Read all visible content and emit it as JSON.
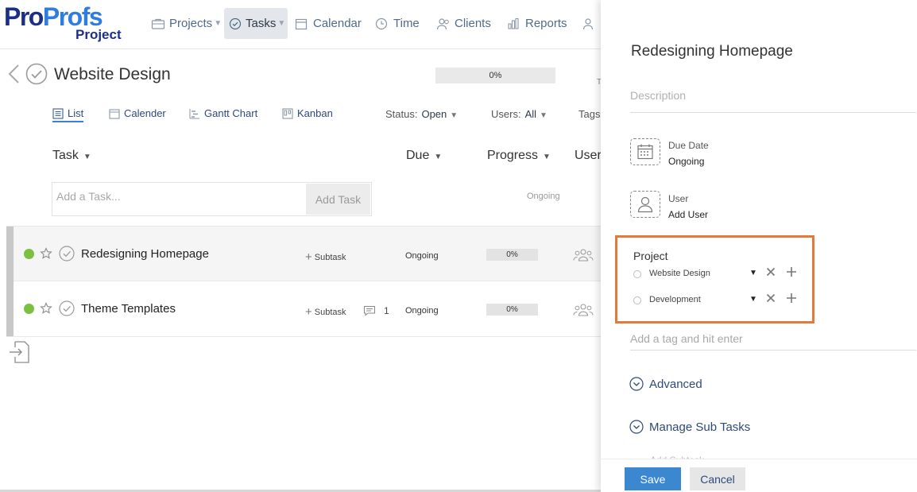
{
  "logo": {
    "part1": "Pro",
    "part2": "Profs",
    "sub": "Project"
  },
  "nav": {
    "projects": "Projects",
    "tasks": "Tasks",
    "calendar": "Calendar",
    "time": "Time",
    "clients": "Clients",
    "reports": "Reports",
    "users_partial": "U"
  },
  "project": {
    "title": "Website Design",
    "progress": "0%",
    "cut_letter": "T"
  },
  "views": {
    "list": "List",
    "calendar": "Calender",
    "gantt": "Gantt Chart",
    "kanban": "Kanban"
  },
  "filters": {
    "status_label": "Status:",
    "status_value": "Open",
    "users_label": "Users:",
    "users_value": "All",
    "tags_label": "Tags"
  },
  "columns": {
    "task": "Task",
    "due": "Due",
    "progress": "Progress",
    "users": "User"
  },
  "add_task": {
    "placeholder": "Add a Task...",
    "button": "Add Task",
    "ongoing": "Ongoing"
  },
  "tasks": [
    {
      "name": "Redesigning Homepage",
      "subtask": "Subtask",
      "comments": "",
      "due": "Ongoing",
      "progress": "0%"
    },
    {
      "name": "Theme Templates",
      "subtask": "Subtask",
      "comments": "1",
      "due": "Ongoing",
      "progress": "0%"
    }
  ],
  "panel": {
    "title": "Redesigning Homepage",
    "description_placeholder": "Description",
    "due_label": "Due Date",
    "due_value": "Ongoing",
    "user_label": "User",
    "user_value": "Add User",
    "project_label": "Project",
    "projects": [
      {
        "name": "Website Design"
      },
      {
        "name": "Development"
      }
    ],
    "tag_placeholder": "Add a tag and hit enter",
    "advanced": "Advanced",
    "manage_subtasks": "Manage Sub Tasks",
    "add_subtask_cut": "Add Subtask",
    "save": "Save",
    "cancel": "Cancel"
  },
  "colors": {
    "accent": "#3b87d0",
    "highlight": "#e07b3c",
    "done_dot": "#7ac142",
    "link": "#2d4a7a"
  }
}
